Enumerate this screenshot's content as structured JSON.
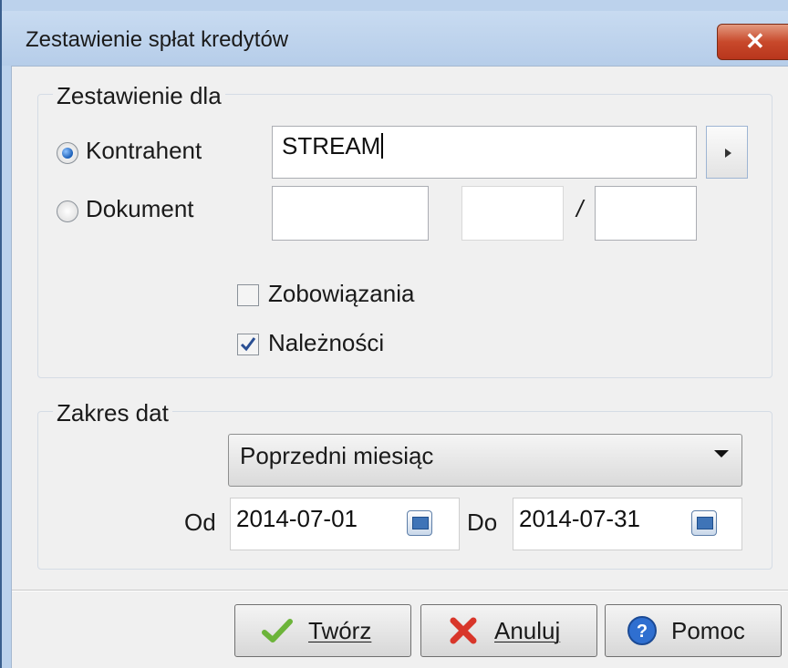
{
  "window": {
    "title": "Zestawienie spłat kredytów",
    "close_label": "✕"
  },
  "group_zestawienie": {
    "legend": "Zestawienie dla",
    "radio_kontrahent": "Kontrahent",
    "radio_dokument": "Dokument",
    "kontrahent_value": "STREAM",
    "dokument_separator": "/",
    "kontrahent_selected": true
  },
  "checkboxes": {
    "zobowiazania": {
      "label": "Zobowiązania",
      "checked": false
    },
    "naleznosci": {
      "label": "Należności",
      "checked": true
    }
  },
  "group_zakres": {
    "legend": "Zakres dat",
    "range_selected": "Poprzedni miesiąc",
    "od_label": "Od",
    "od_value": "2014-07-01",
    "do_label": "Do",
    "do_value": "2014-07-31"
  },
  "buttons": {
    "tworz": "Twórz",
    "anuluj": "Anuluj",
    "pomoc": "Pomoc"
  },
  "icons": {
    "tworz": "checkmark-icon",
    "anuluj": "red-x-icon",
    "pomoc": "help-icon",
    "calendar": "calendar-icon"
  }
}
